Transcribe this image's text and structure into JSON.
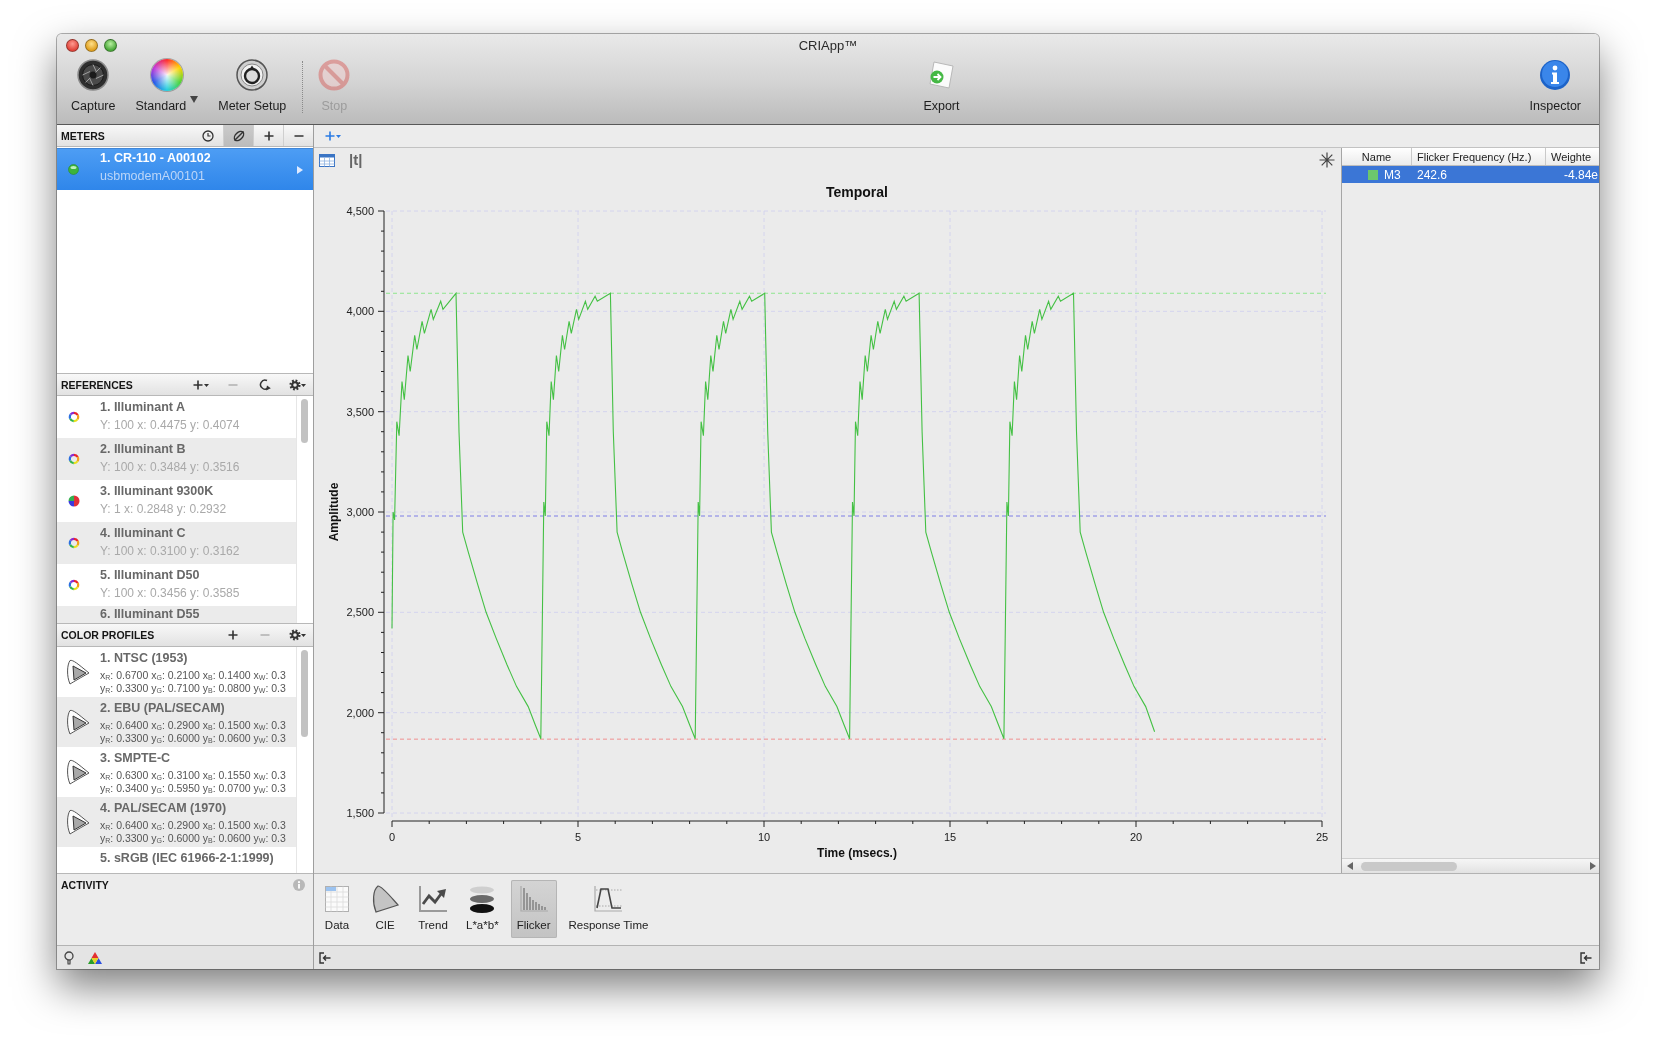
{
  "window": {
    "title": "CRIApp™"
  },
  "toolbar": {
    "left": [
      {
        "kind": "capture",
        "label": "Capture",
        "disabled": false,
        "menu": false
      },
      {
        "kind": "standard",
        "label": "Standard",
        "disabled": false,
        "menu": true
      },
      {
        "kind": "meter_setup",
        "label": "Meter Setup",
        "disabled": false,
        "menu": false
      },
      {
        "kind": "separator"
      },
      {
        "kind": "stop",
        "label": "Stop",
        "disabled": true,
        "menu": false
      }
    ],
    "center": [
      {
        "kind": "export",
        "label": "Export",
        "disabled": false,
        "menu": false
      }
    ],
    "right": [
      {
        "kind": "inspector",
        "label": "Inspector",
        "disabled": false,
        "menu": false
      }
    ]
  },
  "meters": {
    "title": "METERS",
    "buttons": [
      {
        "kind": "clock",
        "pressed": false
      },
      {
        "kind": "slashed_circle",
        "pressed": true
      },
      {
        "kind": "add",
        "pressed": false
      },
      {
        "kind": "remove",
        "pressed": false
      }
    ],
    "items": [
      {
        "name": "1. CR-110 - A00102",
        "port": "usbmodemA00101",
        "connected": true,
        "selected": true
      }
    ]
  },
  "references": {
    "title": "REFERENCES",
    "buttons": [
      {
        "kind": "add_menu",
        "disabled": false
      },
      {
        "kind": "remove",
        "disabled": true
      },
      {
        "kind": "curved_arrow",
        "disabled": false
      },
      {
        "kind": "gear_menu",
        "disabled": false
      }
    ],
    "items": [
      {
        "kind": "ring",
        "name": "1. Illuminant A",
        "values": "Y: 100 x: 0.4475 y: 0.4074"
      },
      {
        "kind": "ring",
        "name": "2. Illuminant B",
        "values": "Y: 100 x: 0.3484 y: 0.3516"
      },
      {
        "kind": "pie",
        "name": "3. Illuminant 9300K",
        "values": "Y: 1 x: 0.2848 y: 0.2932"
      },
      {
        "kind": "ring",
        "name": "4. Illuminant C",
        "values": "Y: 100 x: 0.3100 y: 0.3162"
      },
      {
        "kind": "ring",
        "name": "5. Illuminant D50",
        "values": "Y: 100 x: 0.3456 y: 0.3585"
      },
      {
        "kind": "cut",
        "name": "6. Illuminant D55"
      }
    ]
  },
  "color_profiles": {
    "title": "COLOR PROFILES",
    "buttons": [
      {
        "kind": "add",
        "disabled": false
      },
      {
        "kind": "remove",
        "disabled": true
      },
      {
        "kind": "gear_menu",
        "disabled": false
      }
    ],
    "items": [
      {
        "kind": "gamut",
        "name": "1. NTSC (1953)",
        "x_values": "x$_{R}$: 0.6700 x$_{G}$: 0.2100 x$_{B}$: 0.1400 x$_{W}$: 0.3",
        "y_values": "y$_{R}$: 0.3300 y$_{G}$: 0.7100 y$_{B}$: 0.0800 y$_{W}$: 0.3"
      },
      {
        "kind": "gamut",
        "name": "2. EBU (PAL/SECAM)",
        "x_values": "x$_{R}$: 0.6400 x$_{G}$: 0.2900 x$_{B}$: 0.1500 x$_{W}$: 0.3",
        "y_values": "y$_{R}$: 0.3300 y$_{G}$: 0.6000 y$_{B}$: 0.0600 y$_{W}$: 0.3"
      },
      {
        "kind": "gamut",
        "name": "3. SMPTE-C",
        "x_values": "x$_{R}$: 0.6300 x$_{G}$: 0.3100 x$_{B}$: 0.1550 x$_{W}$: 0.3",
        "y_values": "y$_{R}$: 0.3400 y$_{G}$: 0.5950 y$_{B}$: 0.0700 y$_{W}$: 0.3"
      },
      {
        "kind": "gamut",
        "name": "4. PAL/SECAM (1970)",
        "x_values": "x$_{R}$: 0.6400 x$_{G}$: 0.2900 x$_{B}$: 0.1500 x$_{W}$: 0.3",
        "y_values": "y$_{R}$: 0.3300 y$_{G}$: 0.6000 y$_{B}$: 0.0600 y$_{W}$: 0.3"
      },
      {
        "kind": "cut",
        "name": "5. sRGB (IEC 61966-2-1:1999)"
      }
    ]
  },
  "activity": {
    "title": "ACTIVITY"
  },
  "chart": {
    "view_label": "|t|",
    "chart_data": {
      "type": "line",
      "title": "Temporal",
      "xlabel": "Time (msecs.)",
      "ylabel": "Amplitude",
      "x": [
        0,
        0.03,
        0.07,
        0.13,
        0.19,
        0.27,
        0.33,
        0.43,
        0.49,
        0.61,
        0.67,
        0.81,
        0.87,
        1.05,
        1.11,
        1.31,
        1.37,
        1.72,
        1.8,
        1.9,
        2.05,
        2.3,
        2.53,
        2.8,
        3.09,
        3.35,
        3.66,
        3.85,
        4,
        4.04,
        4.08,
        4.12,
        4.16,
        4.22,
        4.28,
        4.34,
        4.42,
        4.48,
        4.58,
        4.64,
        4.76,
        4.82,
        4.96,
        5.02,
        5.2,
        5.26,
        5.46,
        5.52,
        5.87,
        5.95,
        6.05,
        6.2,
        6.45,
        6.68,
        6.95,
        7.24,
        7.5,
        7.81,
        8,
        8.15,
        8.19,
        8.23,
        8.27,
        8.31,
        8.37,
        8.43,
        8.49,
        8.57,
        8.63,
        8.73,
        8.79,
        8.91,
        8.97,
        9.11,
        9.17,
        9.35,
        9.41,
        9.61,
        9.67,
        10.02,
        10.1,
        10.2,
        10.35,
        10.6,
        10.83,
        11.1,
        11.39,
        11.65,
        11.96,
        12.15,
        12.3,
        12.34,
        12.38,
        12.42,
        12.46,
        12.52,
        12.58,
        12.64,
        12.72,
        12.78,
        12.88,
        12.94,
        13.06,
        13.12,
        13.26,
        13.32,
        13.5,
        13.56,
        13.76,
        13.82,
        14.17,
        14.25,
        14.35,
        14.5,
        14.75,
        14.98,
        15.25,
        15.54,
        15.8,
        16.11,
        16.3,
        16.45,
        16.49,
        16.53,
        16.57,
        16.61,
        16.67,
        16.73,
        16.79,
        16.87,
        16.93,
        17.03,
        17.09,
        17.21,
        17.27,
        17.41,
        17.47,
        17.65,
        17.71,
        17.91,
        17.97,
        18.32,
        18.4,
        18.5,
        18.65,
        18.9,
        19.13,
        19.4,
        19.69,
        19.95,
        20.26,
        20.5
      ],
      "series": [
        {
          "color": "#44c044",
          "values": [
            2420,
            3000,
            2960,
            3450,
            3380,
            3650,
            3560,
            3780,
            3700,
            3880,
            3810,
            3950,
            3890,
            4010,
            3960,
            4050,
            4010,
            4090,
            3400,
            2900,
            2800,
            2640,
            2500,
            2370,
            2240,
            2130,
            2030,
            1940,
            1870,
            2450,
            3050,
            2980,
            3450,
            3380,
            3650,
            3560,
            3780,
            3700,
            3880,
            3810,
            3950,
            3890,
            4010,
            3960,
            4050,
            4010,
            4075,
            4050,
            4090,
            3400,
            2900,
            2800,
            2640,
            2500,
            2370,
            2240,
            2130,
            2030,
            1940,
            1870,
            2450,
            3050,
            2980,
            3450,
            3380,
            3650,
            3560,
            3780,
            3700,
            3880,
            3810,
            3950,
            3890,
            4010,
            3960,
            4050,
            4010,
            4075,
            4050,
            4090,
            3400,
            2900,
            2800,
            2640,
            2500,
            2370,
            2240,
            2130,
            2030,
            1940,
            1870,
            2450,
            3050,
            2980,
            3450,
            3380,
            3650,
            3560,
            3780,
            3700,
            3880,
            3810,
            3950,
            3890,
            4010,
            3960,
            4050,
            4010,
            4075,
            4050,
            4090,
            3400,
            2900,
            2800,
            2640,
            2500,
            2370,
            2240,
            2130,
            2030,
            1940,
            1870,
            2450,
            3050,
            2980,
            3450,
            3380,
            3650,
            3560,
            3780,
            3700,
            3880,
            3810,
            3950,
            3890,
            4010,
            3960,
            4050,
            4010,
            4075,
            4050,
            4090,
            3400,
            2900,
            2800,
            2640,
            2500,
            2370,
            2240,
            2130,
            2030,
            1905
          ]
        }
      ],
      "xlim": [
        0,
        25
      ],
      "ylim": [
        1500,
        4500
      ],
      "xticks": [
        0,
        5,
        10,
        15,
        20,
        25
      ],
      "yticks": [
        {
          "value": 1500,
          "label": "1,500"
        },
        {
          "value": 2000,
          "label": "2,000"
        },
        {
          "value": 2500,
          "label": "2,500"
        },
        {
          "value": 3000,
          "label": "3,000"
        },
        {
          "value": 3500,
          "label": "3,500"
        },
        {
          "value": 4000,
          "label": "4,000"
        },
        {
          "value": 4500,
          "label": "4,500"
        }
      ],
      "grid": true,
      "ref_lines": [
        {
          "axis": "y",
          "value": 4090,
          "color": "#8ee68e"
        },
        {
          "axis": "y",
          "value": 2980,
          "color": "#7c7ce6"
        },
        {
          "axis": "y",
          "value": 1868,
          "color": "#f09090"
        }
      ]
    }
  },
  "results_table": {
    "columns": [
      "Name",
      "Flicker Frequency (Hz.)",
      "Weighte"
    ],
    "rows": [
      {
        "color": "#6cc76c",
        "name": "M3",
        "frequency": "242.6",
        "weighted": "-4.84e",
        "selected": true
      }
    ]
  },
  "views": [
    {
      "kind": "data",
      "label": "Data",
      "selected": false
    },
    {
      "kind": "cie",
      "label": "CIE",
      "selected": false
    },
    {
      "kind": "trend",
      "label": "Trend",
      "selected": false
    },
    {
      "kind": "lab",
      "label": "L*a*b*",
      "selected": false
    },
    {
      "kind": "flicker",
      "label": "Flicker",
      "selected": true
    },
    {
      "kind": "response_time",
      "label": "Response Time",
      "selected": false
    }
  ]
}
